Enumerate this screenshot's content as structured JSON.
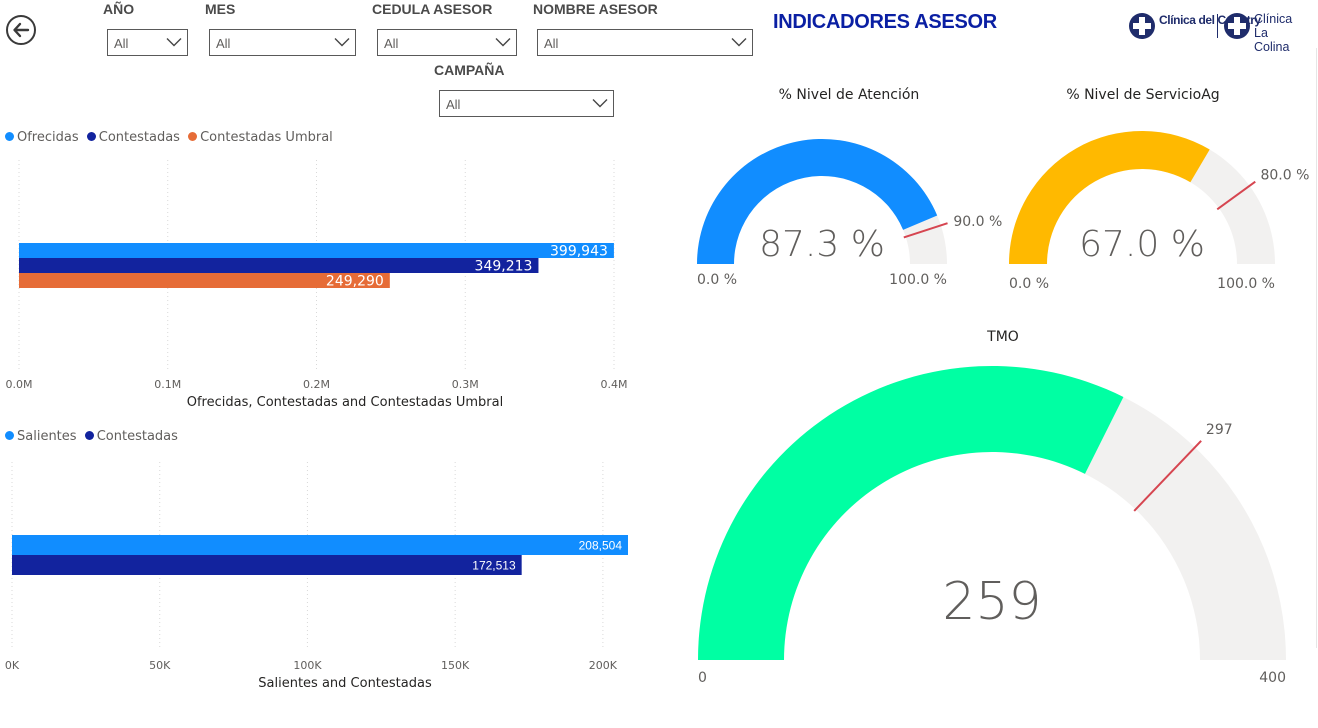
{
  "header": {
    "title": "INDICADORES ASESOR",
    "logos": [
      "Clínica del Country",
      "Clínica La Colina"
    ]
  },
  "slicers": {
    "year": {
      "label": "AÑO",
      "value": "All"
    },
    "month": {
      "label": "MES",
      "value": "All"
    },
    "advisor_id": {
      "label": "CEDULA ASESOR",
      "value": "All"
    },
    "advisor_name": {
      "label": "NOMBRE ASESOR",
      "value": "All"
    },
    "campaign": {
      "label": "CAMPAÑA",
      "value": "All"
    }
  },
  "icons": {
    "back": "back-arrow-circle-icon",
    "dropdown": "chevron-down-icon"
  },
  "colors": {
    "ofrecidas": "#118DFF",
    "contestadas": "#12239E",
    "umbral": "#E66C37",
    "salientes": "#118DFF",
    "gauge_atencion": "#118DFF",
    "gauge_servicio": "#FFB900",
    "gauge_tmo": "#00FFA3",
    "gauge_track": "#F2F1F0",
    "target": "#D64550",
    "title": "#0A1FA3"
  },
  "chart_data": [
    {
      "type": "bar",
      "orientation": "horizontal",
      "legend": [
        "Ofrecidas",
        "Contestadas",
        "Contestadas Umbral"
      ],
      "series": [
        {
          "name": "Ofrecidas",
          "value": 399943,
          "label": "399,943"
        },
        {
          "name": "Contestadas",
          "value": 349213,
          "label": "349,213"
        },
        {
          "name": "Contestadas Umbral",
          "value": 249290,
          "label": "249,290"
        }
      ],
      "xlabel": "Ofrecidas, Contestadas and Contestadas Umbral",
      "xlim": [
        0,
        400000
      ],
      "ticks": [
        {
          "value": 0,
          "label": "0.0M"
        },
        {
          "value": 100000,
          "label": "0.1M"
        },
        {
          "value": 200000,
          "label": "0.2M"
        },
        {
          "value": 300000,
          "label": "0.3M"
        },
        {
          "value": 400000,
          "label": "0.4M"
        }
      ],
      "grid": true,
      "legend_position": "top-left"
    },
    {
      "type": "bar",
      "orientation": "horizontal",
      "legend": [
        "Salientes",
        "Contestadas"
      ],
      "series": [
        {
          "name": "Salientes",
          "value": 208504,
          "label": "208,504"
        },
        {
          "name": "Contestadas",
          "value": 172513,
          "label": "172,513"
        }
      ],
      "xlabel": "Salientes and Contestadas",
      "xlim": [
        0,
        208504
      ],
      "ticks": [
        {
          "value": 0,
          "label": "0K"
        },
        {
          "value": 50000,
          "label": "50K"
        },
        {
          "value": 100000,
          "label": "100K"
        },
        {
          "value": 150000,
          "label": "150K"
        },
        {
          "value": 200000,
          "label": "200K"
        }
      ],
      "grid": true,
      "legend_position": "top-left"
    },
    {
      "type": "gauge",
      "title": "% Nivel de Atención",
      "value": 87.3,
      "value_label": "87.3 %",
      "min": 0,
      "min_label": "0.0 %",
      "max": 100,
      "max_label": "100.0 %",
      "target": 90,
      "target_label": "90.0 %"
    },
    {
      "type": "gauge",
      "title": "% Nivel de ServicioAg",
      "value": 67.0,
      "value_label": "67.0 %",
      "min": 0,
      "min_label": "0.0 %",
      "max": 100,
      "max_label": "100.0 %",
      "target": 80,
      "target_label": "80.0 %"
    },
    {
      "type": "gauge",
      "title": "TMO",
      "value": 259,
      "value_label": "259",
      "min": 0,
      "min_label": "0",
      "max": 400,
      "max_label": "400",
      "target": 297,
      "target_label": "297"
    }
  ]
}
